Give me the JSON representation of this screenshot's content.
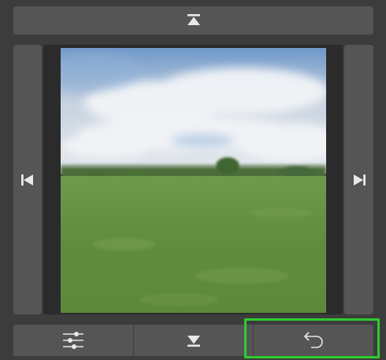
{
  "toolbar": {
    "top": {
      "icon": "move-to-top-icon"
    },
    "left": {
      "icon": "skip-previous-icon"
    },
    "right": {
      "icon": "skip-next-icon"
    },
    "bottom": [
      {
        "icon": "sliders-icon"
      },
      {
        "icon": "move-to-bottom-icon"
      },
      {
        "icon": "undo-icon"
      }
    ]
  },
  "image": {
    "subject": "grass-field-landscape"
  },
  "colors": {
    "panel": "#555555",
    "background": "#3c3c3c",
    "icon": "#e8e8e8",
    "highlight": "#2ecc2e"
  }
}
